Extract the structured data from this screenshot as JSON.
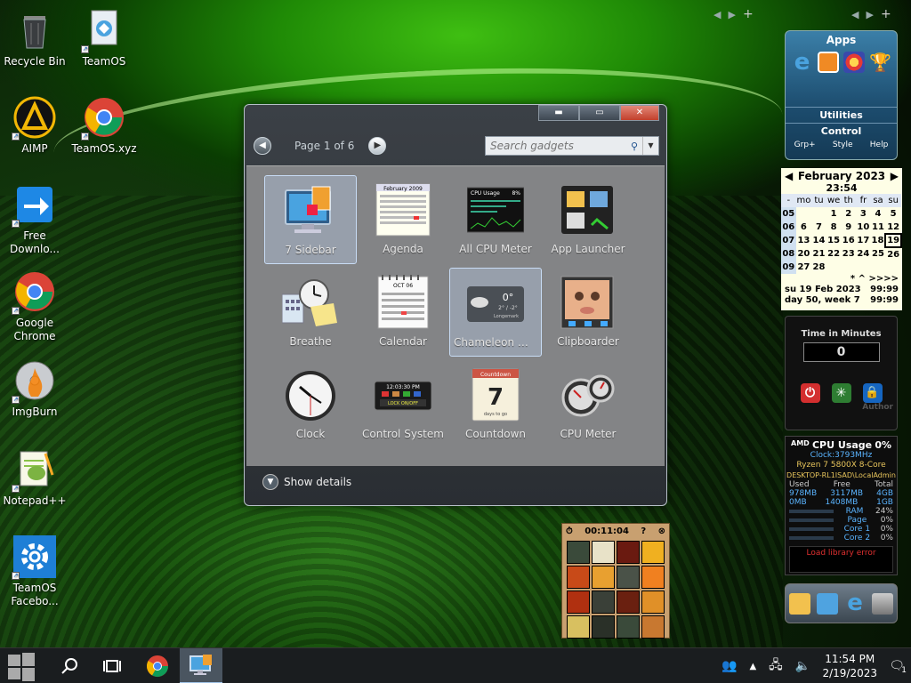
{
  "desktop_icons": [
    {
      "name": "recycle-bin-icon",
      "label": "Recycle Bin"
    },
    {
      "name": "teamos-icon",
      "label": "TeamOS"
    },
    {
      "name": "aimp-icon",
      "label": "AIMP"
    },
    {
      "name": "teamos-xyz-icon",
      "label": "TeamOS.xyz"
    },
    {
      "name": "free-download-icon",
      "label": "Free Downlo..."
    },
    {
      "name": "google-chrome-icon",
      "label": "Google Chrome"
    },
    {
      "name": "imgburn-icon",
      "label": "ImgBurn"
    },
    {
      "name": "notepad-plus-icon",
      "label": "Notepad++"
    },
    {
      "name": "teamos-facebook-icon",
      "label": "TeamOS Facebo..."
    }
  ],
  "gadget_window": {
    "page_text": "Page 1 of 6",
    "search_placeholder": "Search gadgets",
    "gadgets": [
      {
        "label": "7 Sidebar",
        "selected": true
      },
      {
        "label": "Agenda",
        "selected": false
      },
      {
        "label": "All CPU Meter",
        "selected": false
      },
      {
        "label": "App Launcher",
        "selected": false
      },
      {
        "label": "Breathe",
        "selected": false
      },
      {
        "label": "Calendar",
        "selected": false
      },
      {
        "label": "Chameleon We...",
        "selected": true
      },
      {
        "label": "Clipboarder",
        "selected": false
      },
      {
        "label": "Clock",
        "selected": false
      },
      {
        "label": "Control System",
        "selected": false
      },
      {
        "label": "Countdown",
        "selected": false
      },
      {
        "label": "CPU Meter",
        "selected": false
      }
    ],
    "show_details": "Show details",
    "thumb_text": {
      "agenda_header": "February 2009",
      "cpu_usage": "CPU Usage",
      "cpu_pct": "8%",
      "chameleon_temp": "0°",
      "chameleon_range": "2° / -2°",
      "chameleon_place": "Longemark",
      "control_time": "12:03:30 PM",
      "control_lock": "LOCK ON/OFF",
      "countdown_title": "Countdown",
      "countdown_num": "7",
      "countdown_sub": "days to go",
      "calendar_month": "OCT 06"
    }
  },
  "apps_gadget": {
    "title": "Apps",
    "utilities": "Utilities",
    "control": "Control",
    "links": [
      "Grp+",
      "Style",
      "Help"
    ]
  },
  "calendar_gadget": {
    "month": "February 2023",
    "time": "23:54",
    "weekday_header": [
      "-",
      "mo",
      "tu",
      "we",
      "th",
      "fr",
      "sa",
      "su"
    ],
    "weeks": [
      [
        "05",
        "",
        "",
        "1",
        "2",
        "3",
        "4",
        "5"
      ],
      [
        "06",
        "6",
        "7",
        "8",
        "9",
        "10",
        "11",
        "12"
      ],
      [
        "07",
        "13",
        "14",
        "15",
        "16",
        "17",
        "18",
        "19"
      ],
      [
        "08",
        "20",
        "21",
        "22",
        "23",
        "24",
        "25",
        "26"
      ],
      [
        "09",
        "27",
        "28",
        "",
        "",
        "",
        "",
        ""
      ]
    ],
    "nav": "*   ^  >>>>",
    "line1_left": "su 19 Feb 2023",
    "line1_right": "99:99",
    "line2_left": "day 50, week 7",
    "line2_right": "99:99"
  },
  "timer_gadget": {
    "title": "Time in Minutes",
    "value": "0",
    "author": "Author"
  },
  "cpu_gadget": {
    "brand": "AMD",
    "title": "CPU Usage",
    "pct": "0%",
    "clock": "Clock:3793MHz",
    "model": "Ryzen 7 5800X 8-Core",
    "host": "DESKTOP-RL1ISAD\\LocalAdmin",
    "headers": [
      "Used",
      "Free",
      "Total"
    ],
    "row1": [
      "978MB",
      "3117MB",
      "4GB"
    ],
    "row2": [
      "0MB",
      "1408MB",
      "1GB"
    ],
    "meters": [
      {
        "label": "RAM",
        "value": "24%"
      },
      {
        "label": "Page",
        "value": "0%"
      },
      {
        "label": "Core 1",
        "value": "0%"
      },
      {
        "label": "Core 2",
        "value": "0%"
      }
    ],
    "error": "Load library error"
  },
  "puzzle_gadget": {
    "time": "00:11:04"
  },
  "taskbar": {
    "time": "11:54 PM",
    "date": "2/19/2023",
    "notif_count": "1"
  }
}
